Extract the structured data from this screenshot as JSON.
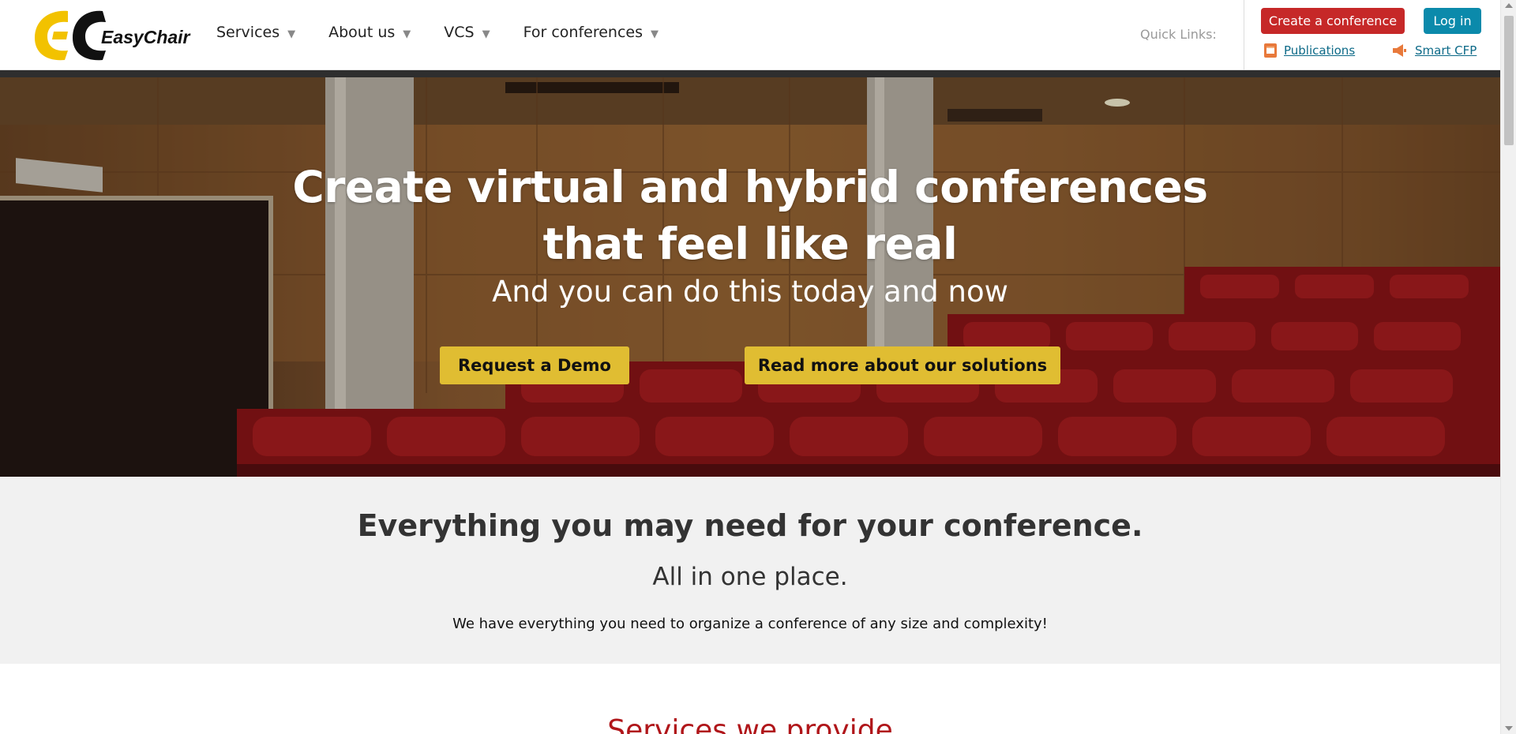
{
  "brand": {
    "name": "EasyChair"
  },
  "nav": {
    "items": [
      {
        "label": "Services"
      },
      {
        "label": "About us"
      },
      {
        "label": "VCS"
      },
      {
        "label": "For conferences"
      }
    ]
  },
  "quick_links": {
    "label": "Quick Links:",
    "publications": "Publications",
    "smart_cfp": "Smart CFP"
  },
  "header_buttons": {
    "create": "Create a conference",
    "login": "Log in"
  },
  "hero": {
    "title_line1": "Create virtual and hybrid conferences",
    "title_line2": "that feel like real",
    "subtitle": "And you can do this today and now",
    "demo_button": "Request a Demo",
    "readmore_button": "Read more about our solutions"
  },
  "info": {
    "title": "Everything you may need for your conference.",
    "subtitle": "All in one place.",
    "text": "We have everything you need to organize a conference of any size and complexity!"
  },
  "services": {
    "heading": "Services we provide"
  },
  "colors": {
    "create_button": "#c62828",
    "login_button": "#0b8aab",
    "hero_button": "#e0bd32",
    "link": "#0d6a88",
    "services_heading": "#b0161a"
  }
}
